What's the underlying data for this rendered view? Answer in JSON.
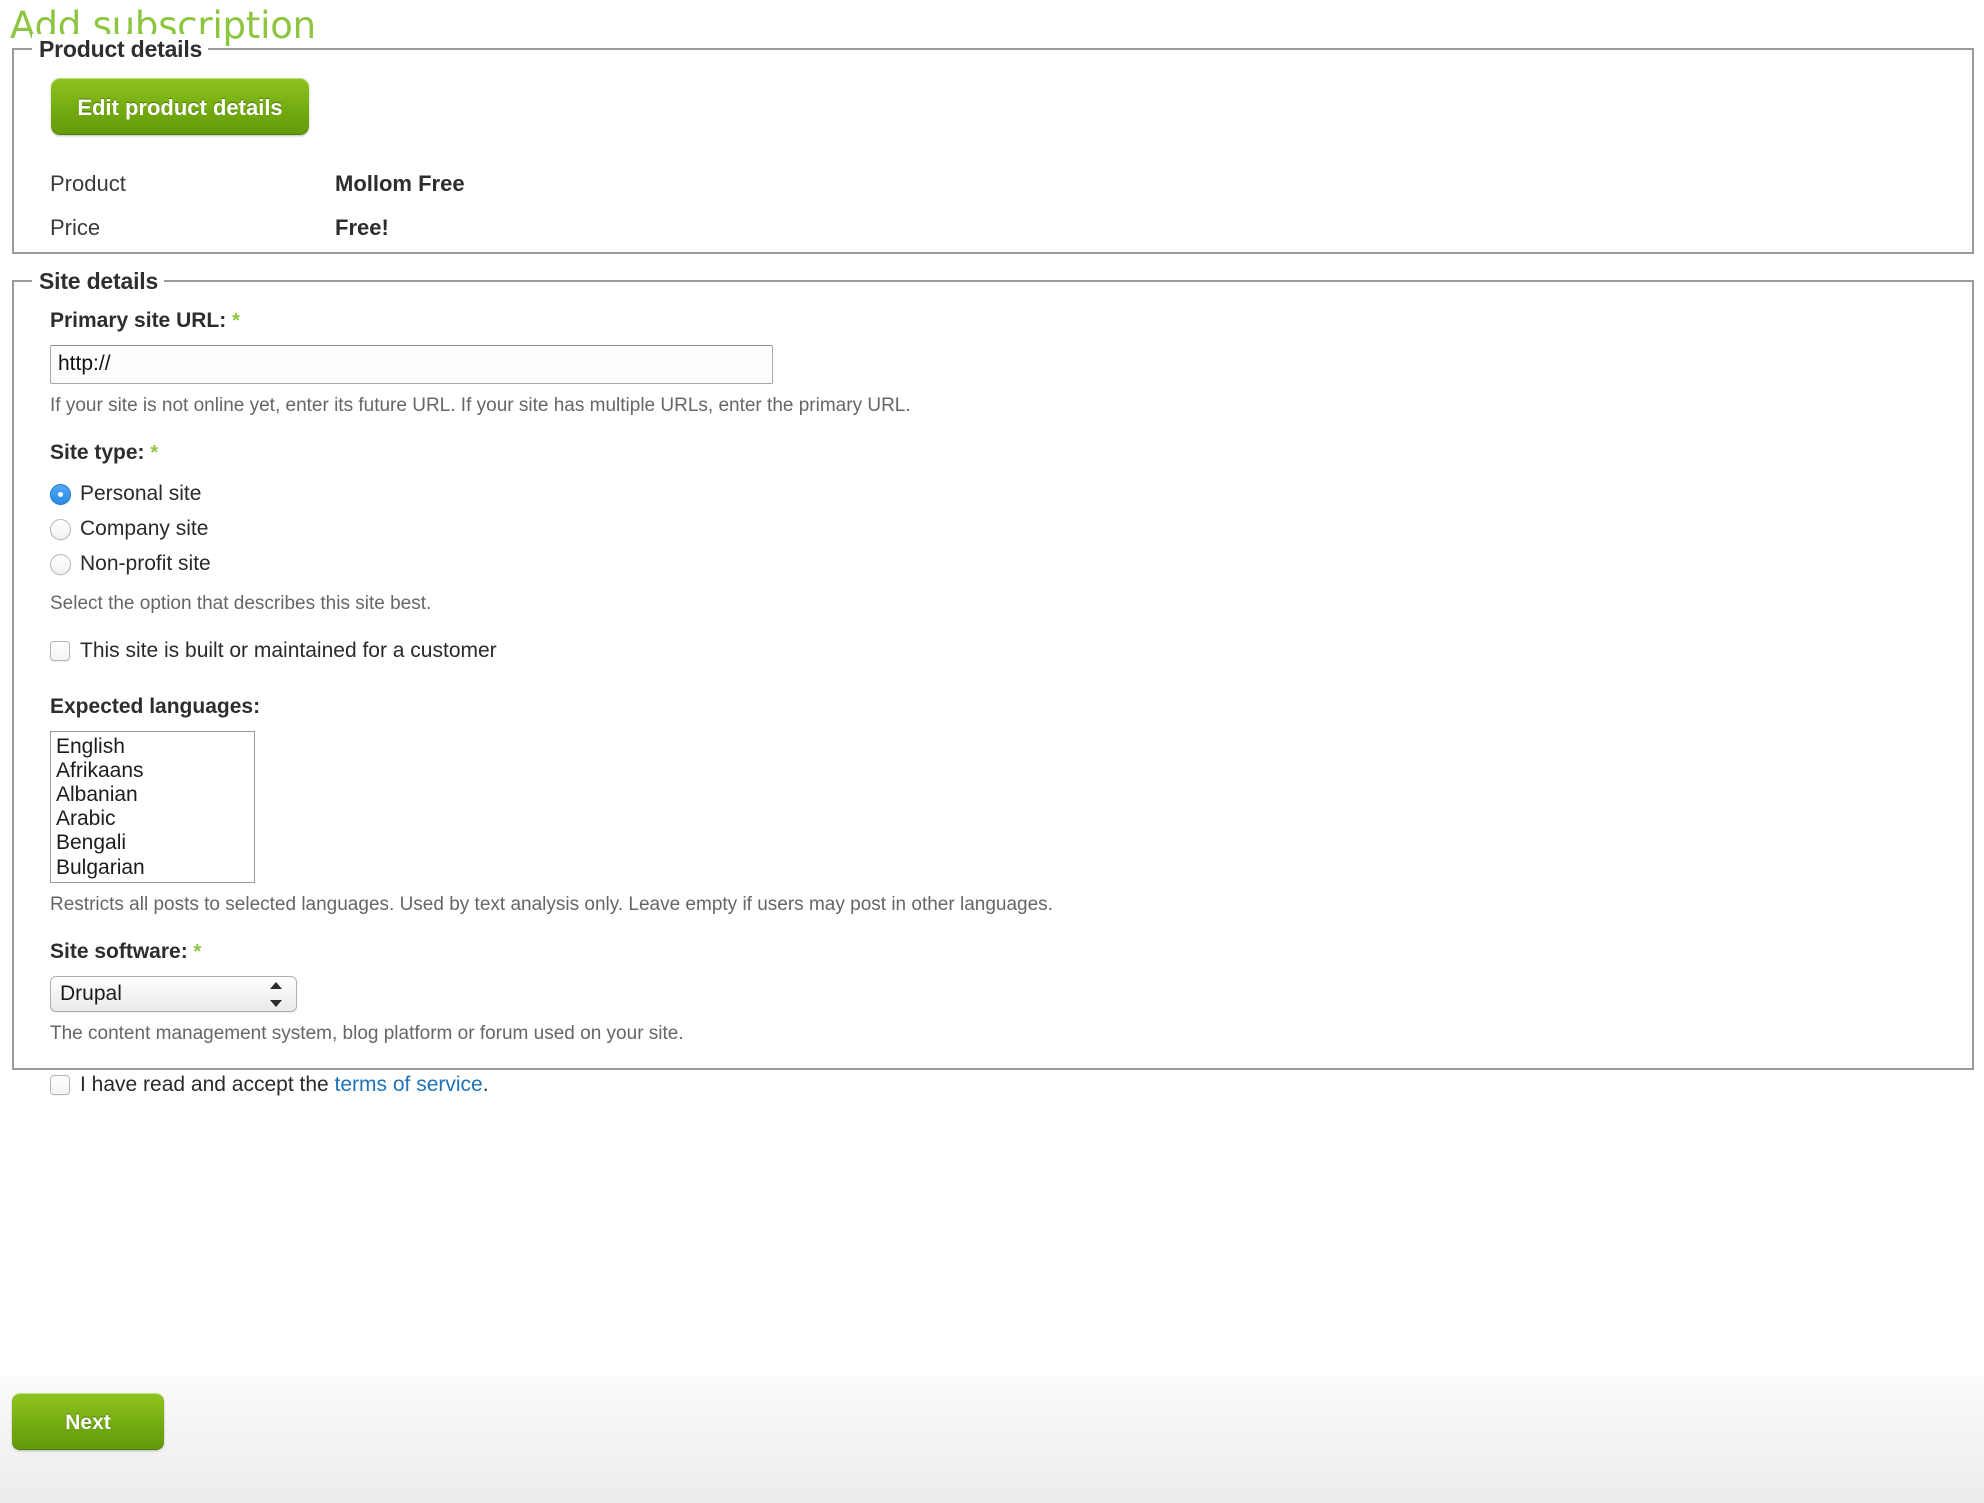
{
  "page": {
    "title": "Add subscription",
    "title_color": "#8cc63e"
  },
  "product_details": {
    "legend": "Product details",
    "edit_button_label": "Edit product details",
    "rows": [
      {
        "key": "Product",
        "value": "Mollom Free"
      },
      {
        "key": "Price",
        "value": "Free!"
      }
    ]
  },
  "site_details": {
    "legend": "Site details",
    "primary_site_url": {
      "label": "Primary site URL:",
      "required_marker": "*",
      "value": "http://",
      "placeholder": "http://",
      "description": "If your site is not online yet, enter its future URL. If your site has multiple URLs, enter the primary URL."
    },
    "site_type": {
      "label": "Site type:",
      "required_marker": "*",
      "options": [
        {
          "label": "Personal site",
          "checked": true
        },
        {
          "label": "Company site",
          "checked": false
        },
        {
          "label": "Non-profit site",
          "checked": false
        }
      ],
      "description": "Select the option that describes this site best."
    },
    "customer_checkbox": {
      "label": "This site is built or maintained for a customer",
      "checked": false
    },
    "expected_languages": {
      "label": "Expected languages:",
      "options": [
        "English",
        "Afrikaans",
        "Albanian",
        "Arabic",
        "Bengali",
        "Bulgarian"
      ],
      "description": "Restricts all posts to selected languages. Used by text analysis only. Leave empty if users may post in other languages."
    },
    "site_software": {
      "label": "Site software:",
      "required_marker": "*",
      "selected": "Drupal",
      "description": "The content management system, blog platform or forum used on your site."
    },
    "terms": {
      "text_before": "I have read and accept the ",
      "link_label": "terms of service",
      "text_after": ".",
      "link_color": "#1d72b8",
      "checked": false
    }
  },
  "actions": {
    "next_label": "Next"
  }
}
